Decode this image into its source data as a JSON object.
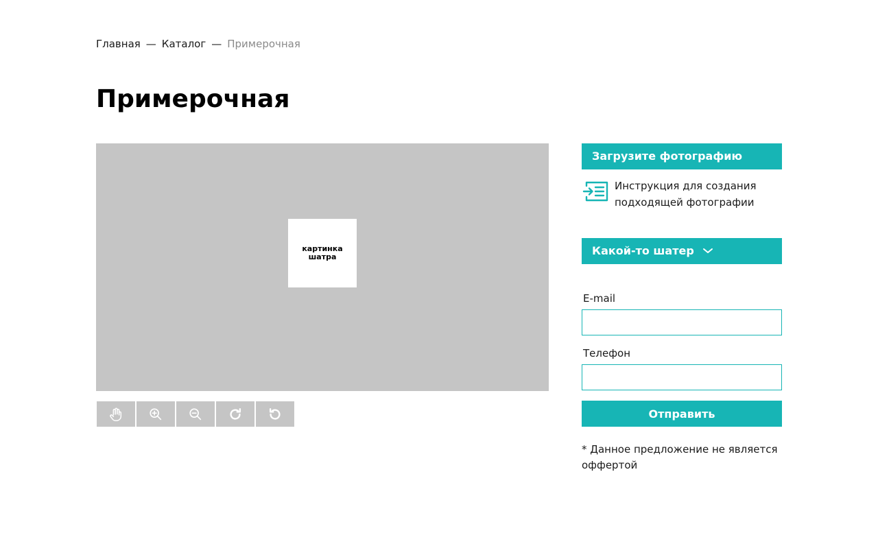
{
  "breadcrumb": {
    "items": [
      "Главная",
      "Каталог"
    ],
    "separator": "—",
    "current": "Примерочная"
  },
  "page": {
    "title": "Примерочная"
  },
  "canvas": {
    "background": "#c5c5c5",
    "thumbnail_text": "картинка шатра"
  },
  "toolbar": {
    "tools": [
      "hand-icon",
      "zoom-in-icon",
      "zoom-out-icon",
      "rotate-right-icon",
      "rotate-left-icon"
    ]
  },
  "sidebar": {
    "upload_label": "Загрузите фотографию",
    "instruction_text": "Инструкция для создания подходящей фотографии",
    "tent_select_value": "Какой-то шатер",
    "email_label": "E-mail",
    "email_value": "",
    "phone_label": "Телефон",
    "phone_value": "",
    "submit_label": "Отправить",
    "disclaimer": "* Данное предложение не является оффертой"
  },
  "colors": {
    "accent": "#17b5b5",
    "canvas_gray": "#c5c5c5",
    "tool_icon": "#ffffff",
    "text_muted": "#8a8a8a"
  }
}
